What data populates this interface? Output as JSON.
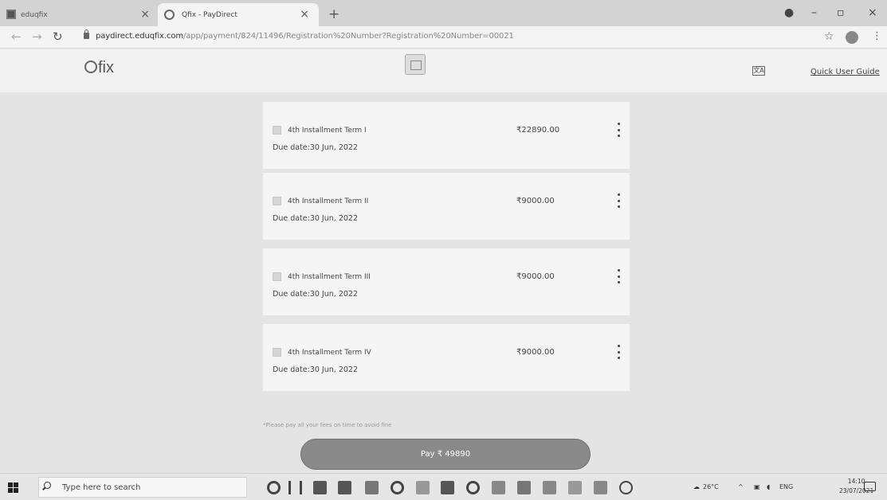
{
  "browser": {
    "tabs": [
      {
        "label": "eduqfix"
      },
      {
        "label": "Qfix - PayDirect"
      }
    ],
    "new_tab_label": "+",
    "url_domain": "paydirect.eduqfix.com",
    "url_path": "/app/payment/824/11496/Registration%20Number?Registration%20Number=00021"
  },
  "page": {
    "brand": "fix",
    "quick_guide": "Quick User Guide"
  },
  "installments": [
    {
      "name": "4th Installment Term I",
      "amount": "₹22890.00",
      "due": "Due date:30 Jun, 2022"
    },
    {
      "name": "4th Installment Term II",
      "amount": "₹9000.00",
      "due": "Due date:30 Jun, 2022"
    },
    {
      "name": "4th Installment Term III",
      "amount": "₹9000.00",
      "due": "Due date:30 Jun, 2022"
    },
    {
      "name": "4th Installment Term IV",
      "amount": "₹9000.00",
      "due": "Due date:30 Jun, 2022"
    }
  ],
  "footer_note": "*Please pay all your fees on time to avoid fine",
  "pay_button": "Pay ₹ 49890",
  "taskbar": {
    "search_placeholder": "Type here to search",
    "temperature": "26°C",
    "language": "ENG",
    "time": "14:10",
    "date": "23/07/2021"
  }
}
